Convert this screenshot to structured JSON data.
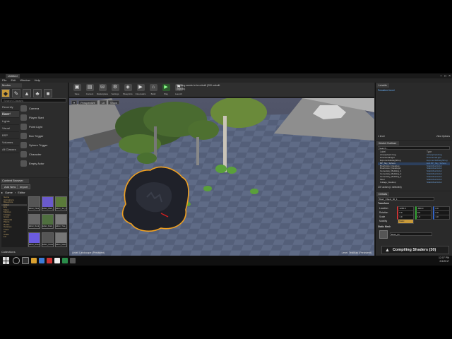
{
  "window": {
    "tab_title": "Untitled",
    "menu": [
      "File",
      "Edit",
      "Window",
      "Help"
    ],
    "controls": [
      "–",
      "□",
      "×"
    ]
  },
  "modes": {
    "tab": "Modes",
    "search_placeholder": "Search Classes",
    "categories": [
      "Recently Placed",
      "Basic",
      "Lights",
      "Visual",
      "BSP",
      "Volumes",
      "All Classes"
    ],
    "selected_category": "Basic",
    "items": [
      "Camera",
      "Player Start",
      "Point Light",
      "Box Trigger",
      "Sphere Trigger",
      "Character",
      "Empty Actor"
    ]
  },
  "content_browser": {
    "tab": "Content Browser",
    "add_new": "Add New",
    "import": "Import",
    "path": [
      "Game",
      "Editor"
    ],
    "filters": "Filters",
    "search_placeholder": "Search Editor",
    "tree": [
      "Game",
      "Animations",
      "Blueprints",
      "Editor",
      "Env",
      "Maps",
      "Meshes",
      "Foliage",
      "Grass",
      "Materials",
      "Plants",
      "Rocks",
      "Textures",
      "Trees",
      "UI",
      "Audio",
      "FX"
    ],
    "assets": [
      "Editor_Plant_01",
      "Editor_Plant_02",
      "Editor_Tex_03",
      "Editor_Rock_04",
      "Editor_Bush_05",
      "Editor_Tree_06",
      "Editor_Grass_07",
      "Editor_Grass_08",
      "Editor_Mesh_09"
    ],
    "footer": "Collections"
  },
  "toolbar": {
    "buttons": [
      "Save",
      "Content",
      "Marketplace",
      "Settings",
      "Blueprints",
      "Cinematics",
      "Build",
      "Play",
      "Launch"
    ],
    "notice": "Lighting needs to be rebuilt (200 unbuilt objects)"
  },
  "viewport": {
    "perspective": "Perspective",
    "lit": "Lit",
    "show": "Show",
    "stats_text": "Level: Landscape (Persistent)",
    "level_text": "Level: TestMap (Persistent)"
  },
  "levels": {
    "tab": "Levels",
    "rows": [
      "Persistent Level"
    ],
    "footer_left": "1 level",
    "footer_right": "View Options"
  },
  "outliner": {
    "tab": "World Outliner",
    "search_placeholder": "Search...",
    "col_label": "Label",
    "col_type": "Type",
    "rows": [
      {
        "label": "Atmospheric Fog",
        "type": "AtmosphericFog"
      },
      {
        "label": "DirectionalLight",
        "type": "DirectionalLight"
      },
      {
        "label": "ExponentialHeightFog",
        "type": "ExponentialHeightFog"
      },
      {
        "label": "BP_Sky_Sphere",
        "type": "Edit BP_Sky_Sphere"
      },
      {
        "label": "BrushActor_Desktop",
        "type": "StaticMeshActor"
      },
      {
        "label": "BrushActor_Desktop2",
        "type": "StaticMeshActor"
      },
      {
        "label": "Cementary_Building_1",
        "type": "StaticMeshActor"
      },
      {
        "label": "Cementary_Building_2",
        "type": "StaticMeshActor"
      },
      {
        "label": "Cementary_Building_3",
        "type": "StaticMeshActor"
      },
      {
        "label": "Floor",
        "type": "StaticMeshActor"
      },
      {
        "label": "Foliage_Desktop",
        "type": "StaticMeshActor"
      }
    ],
    "footer": "237 actors (1 selected)"
  },
  "details": {
    "tab": "Details",
    "object_name": "Bush_Object_00_1",
    "transform_header": "Transform",
    "location": [
      "1265.0",
      "-830.0",
      "0.0"
    ],
    "rotation": [
      "0.0",
      "0.0",
      "0.0"
    ],
    "scale": [
      "1.0",
      "1.0",
      "1.0"
    ],
    "mobility": "Static",
    "static_mesh_header": "Static Mesh",
    "static_mesh_value": "Bush_01"
  },
  "toast": {
    "text": "Compiling Shaders (30)"
  },
  "taskbar": {
    "time": "12:07 PM",
    "date": "2/4/2017"
  },
  "colors": {
    "selection_outline": "#f0a020",
    "accent_orange": "#c89a3a",
    "sky": "#4a4e62"
  }
}
